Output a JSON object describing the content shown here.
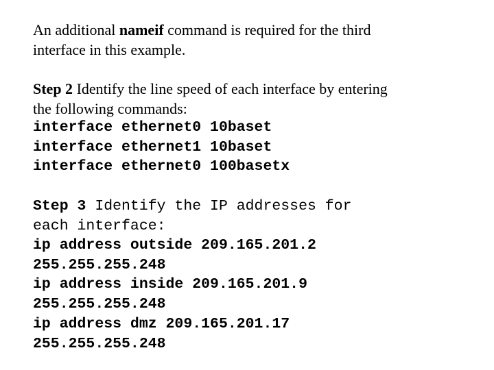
{
  "intro": {
    "line1_before": "An additional ",
    "line1_bold": "nameif",
    "line1_after": " command is required for the third",
    "line2": "interface in this example."
  },
  "step2": {
    "label": "Step 2",
    "line1_text": " Identify the line speed of each interface by entering",
    "line2_text": "the following commands:",
    "commands": [
      "interface ethernet0 10baset",
      "interface ethernet1 10baset",
      "interface ethernet0 100basetx"
    ]
  },
  "step3": {
    "label": "Step 3",
    "line1_text": " Identify the IP addresses for",
    "line2_text": "each interface:",
    "commands": [
      "ip address outside 209.165.201.2",
      "255.255.255.248",
      "ip address inside 209.165.201.9",
      "255.255.255.248",
      "ip address dmz 209.165.201.17",
      "255.255.255.248"
    ]
  }
}
